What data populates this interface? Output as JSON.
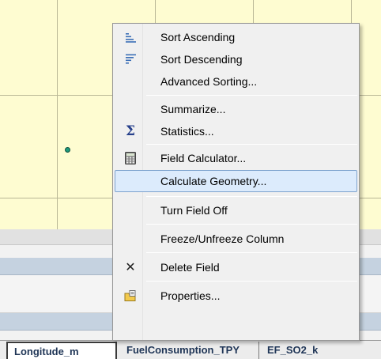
{
  "context_menu": {
    "items": [
      {
        "label": "Sort Ascending",
        "icon": "sort-ascending-icon"
      },
      {
        "label": "Sort Descending",
        "icon": "sort-descending-icon"
      },
      {
        "label": "Advanced Sorting...",
        "icon": ""
      },
      {
        "label": "Summarize...",
        "icon": ""
      },
      {
        "label": "Statistics...",
        "icon": "sigma-icon"
      },
      {
        "label": "Field Calculator...",
        "icon": "calculator-icon"
      },
      {
        "label": "Calculate Geometry...",
        "icon": "",
        "highlighted": true
      },
      {
        "label": "Turn Field Off",
        "icon": ""
      },
      {
        "label": "Freeze/Unfreeze Column",
        "icon": ""
      },
      {
        "label": "Delete Field",
        "icon": "delete-x-icon"
      },
      {
        "label": "Properties...",
        "icon": "properties-icon"
      }
    ],
    "highlight_color": "#dcebfc"
  },
  "table": {
    "columns": [
      "Longitude_m",
      "FuelConsumption_TPY",
      "EF_SO2_k"
    ],
    "selected_column": "Longitude_m"
  },
  "colors": {
    "map_background": "#fefcd1",
    "grid_line": "#b9b796",
    "point": "#1e9a7b",
    "selected_row": "#c5d2e0"
  }
}
